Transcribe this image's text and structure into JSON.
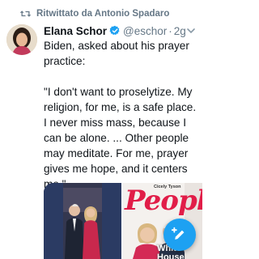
{
  "retweet": {
    "label": "Ritwittato da Antonio Spadaro",
    "icon": "retweet-icon"
  },
  "tweet": {
    "author_name": "Elana Schor",
    "handle": "@eschor",
    "separator": "·",
    "time": "2g",
    "verified": true,
    "text_intro": "Biden, asked about his prayer practice:",
    "text_quote": "\"I don't want to proselytize. My religion, for me, is a safe place. I never miss mass, because I can be alone. ... Other people may meditate. For me, prayer gives me hope, and it centers me.\""
  },
  "media": {
    "magazine_title": "People",
    "magazine_small_text": "Cicely Tyson",
    "magazine_bottom_text": "White House Interview"
  },
  "colors": {
    "accent": "#1da1f2",
    "muted": "#657786",
    "magazine_red": "#e11d48"
  },
  "fab": {
    "icon": "compose-icon"
  }
}
